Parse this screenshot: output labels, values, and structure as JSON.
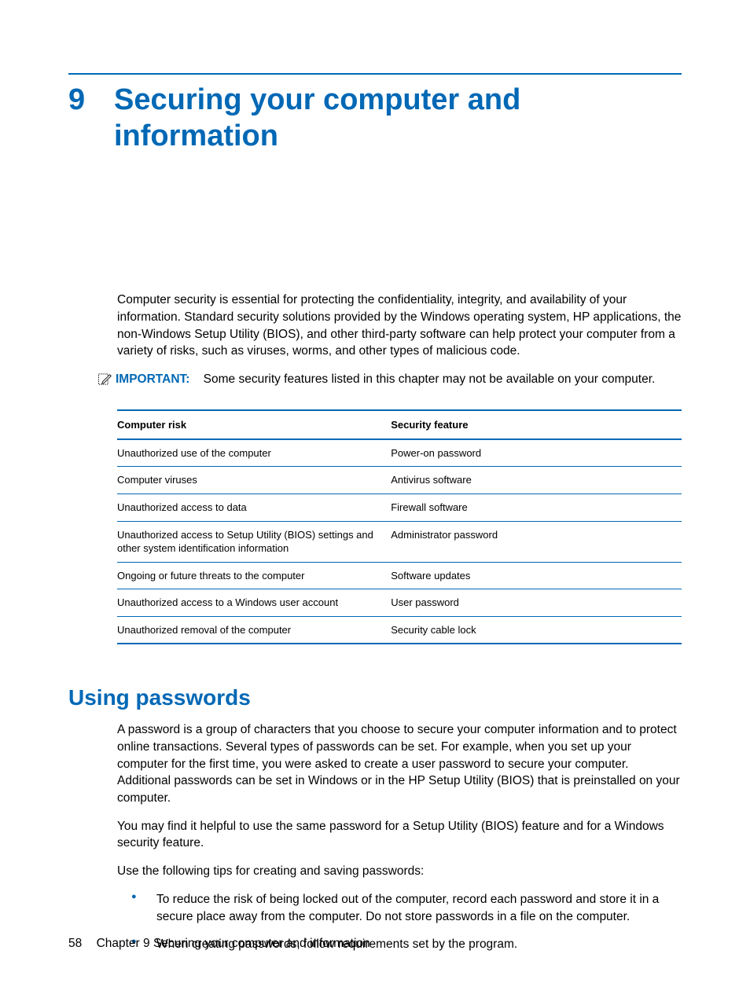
{
  "chapter": {
    "number": "9",
    "title": "Securing your computer and information"
  },
  "intro_paragraph": "Computer security is essential for protecting the confidentiality, integrity, and availability of your information. Standard security solutions provided by the Windows operating system, HP applications, the non-Windows Setup Utility (BIOS), and other third-party software can help protect your computer from a variety of risks, such as viruses, worms, and other types of malicious code.",
  "important": {
    "label": "IMPORTANT:",
    "text": "Some security features listed in this chapter may not be available on your computer."
  },
  "table": {
    "headers": [
      "Computer risk",
      "Security feature"
    ],
    "rows": [
      [
        "Unauthorized use of the computer",
        "Power-on password"
      ],
      [
        "Computer viruses",
        "Antivirus software"
      ],
      [
        "Unauthorized access to data",
        "Firewall software"
      ],
      [
        "Unauthorized access to Setup Utility (BIOS) settings and other system identification information",
        "Administrator password"
      ],
      [
        "Ongoing or future threats to the computer",
        "Software updates"
      ],
      [
        "Unauthorized access to a Windows user account",
        "User password"
      ],
      [
        "Unauthorized removal of the computer",
        "Security cable lock"
      ]
    ]
  },
  "section": {
    "heading": "Using passwords",
    "p1": "A password is a group of characters that you choose to secure your computer information and to protect online transactions. Several types of passwords can be set. For example, when you set up your computer for the first time, you were asked to create a user password to secure your computer. Additional passwords can be set in Windows or in the HP Setup Utility (BIOS) that is preinstalled on your computer.",
    "p2": "You may find it helpful to use the same password for a Setup Utility (BIOS) feature and for a Windows security feature.",
    "p3": "Use the following tips for creating and saving passwords:",
    "bullets": [
      "To reduce the risk of being locked out of the computer, record each password and store it in a secure place away from the computer. Do not store passwords in a file on the computer.",
      "When creating passwords, follow requirements set by the program."
    ]
  },
  "footer": {
    "page": "58",
    "text": "Chapter 9   Securing your computer and information"
  }
}
